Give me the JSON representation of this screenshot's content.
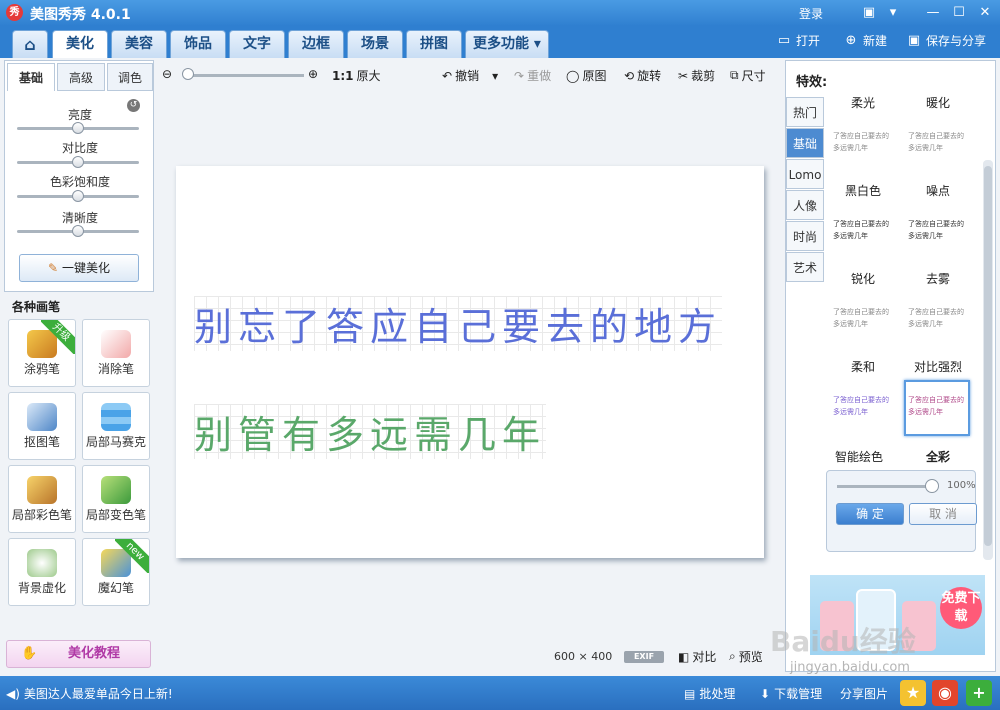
{
  "app": {
    "title": "美图秀秀 4.0.1",
    "logo_text": "秀",
    "login": "登录"
  },
  "window_icons": [
    "message-icon",
    "skin-icon",
    "minimize-icon",
    "maximize-icon",
    "close-icon"
  ],
  "tabs": [
    {
      "label": "美化",
      "active": true
    },
    {
      "label": "美容"
    },
    {
      "label": "饰品"
    },
    {
      "label": "文字"
    },
    {
      "label": "边框"
    },
    {
      "label": "场景"
    },
    {
      "label": "拼图"
    },
    {
      "label": "更多功能"
    }
  ],
  "top_actions": {
    "open": "打开",
    "new": "新建",
    "save": "保存与分享"
  },
  "left_tabs": [
    "基础",
    "高级",
    "调色"
  ],
  "sliders": [
    {
      "label": "亮度",
      "value": 0.5
    },
    {
      "label": "对比度",
      "value": 0.5
    },
    {
      "label": "色彩饱和度",
      "value": 0.5
    },
    {
      "label": "清晰度",
      "value": 0.5
    }
  ],
  "one_key": "一键美化",
  "brushes": {
    "header": "各种画笔",
    "items": [
      {
        "label": "涂鸦笔",
        "badge": "升级"
      },
      {
        "label": "消除笔"
      },
      {
        "label": "抠图笔"
      },
      {
        "label": "局部马赛克"
      },
      {
        "label": "局部彩色笔"
      },
      {
        "label": "局部变色笔"
      },
      {
        "label": "背景虚化"
      },
      {
        "label": "魔幻笔",
        "badge": "new"
      }
    ]
  },
  "tutorial": "美化教程",
  "toolbar": {
    "zoom_ratio": "1:1",
    "original_size": "原大",
    "undo": "撤销",
    "redo": "重做",
    "original": "原图",
    "rotate": "旋转",
    "crop": "裁剪",
    "resize": "尺寸"
  },
  "canvas": {
    "line1": "别忘了答应自己要去的地方",
    "line2": "别管有多远需几年",
    "width": "600",
    "times": "×",
    "height": "400",
    "exif": "EXIF",
    "compare": "对比",
    "preview": "预览"
  },
  "effects": {
    "title": "特效:",
    "categories": [
      {
        "label": "热门"
      },
      {
        "label": "基础",
        "active": true
      },
      {
        "label": "Lomo"
      },
      {
        "label": "人像"
      },
      {
        "label": "时尚"
      },
      {
        "label": "艺术"
      }
    ],
    "items": [
      {
        "label": "柔光"
      },
      {
        "label": "暖化"
      },
      {
        "label": "黑白色"
      },
      {
        "label": "噪点"
      },
      {
        "label": "锐化"
      },
      {
        "label": "去雾"
      },
      {
        "label": "柔和"
      },
      {
        "label": "对比强烈",
        "selected": true
      },
      {
        "label": "智能绘色"
      },
      {
        "label": "全彩"
      }
    ],
    "preview_line1": "了答应自己要去的",
    "preview_line2": "多远需几年",
    "strength": "100%",
    "strength_value": 1.0,
    "confirm": "确 定",
    "cancel": "取 消"
  },
  "ad": {
    "button": "免费下载"
  },
  "status": {
    "message": "美图达人最爱单品今日上新!",
    "batch": "批处理",
    "download": "下载管理",
    "share": "分享图片"
  },
  "watermark": {
    "text": "Baidu经验",
    "url": "jingyan.baidu.com"
  },
  "colors": {
    "accent": "#2f7fd0",
    "selected_tab": "#4d8bd1",
    "ribbon_green": "#3cae3c"
  }
}
